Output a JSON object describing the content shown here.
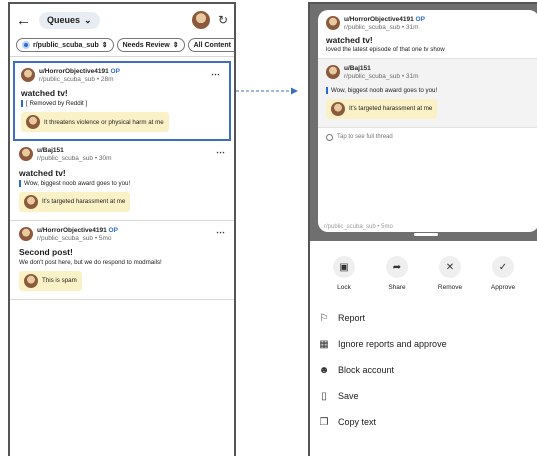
{
  "left": {
    "header": {
      "queue_label": "Queues",
      "chevron": "chevron-down-icon",
      "refresh_icon": "refresh-icon"
    },
    "filters": [
      {
        "label": "r/public_scuba_sub"
      },
      {
        "label": "Needs Review"
      },
      {
        "label": "All Content"
      }
    ],
    "posts": [
      {
        "user": "u/HorrorObjective4191",
        "op": "OP",
        "sub_time": "r/public_scuba_sub • 28m",
        "title": "watched tv!",
        "body": "[ Removed by Reddit ]",
        "report": "It threatens violence or physical harm at me"
      },
      {
        "user": "u/Baj151",
        "sub_time": "r/public_scuba_sub • 30m",
        "title": "watched tv!",
        "body": "Wow, biggest noob award goes to you!",
        "report": "It's targeted harassment at me"
      },
      {
        "user": "u/HorrorObjective4191",
        "op": "OP",
        "sub_time": "r/public_scuba_sub • 5mo",
        "title": "Second post!",
        "body": "We don't post here, but we do respond to modmails!",
        "report": "This is spam"
      }
    ]
  },
  "right": {
    "thread": {
      "user": "u/HorrorObjective4191",
      "op": "OP",
      "sub_time": "r/public_scuba_sub • 31m",
      "title": "watched tv!",
      "body": "loved the latest episode of that one tv show",
      "comment_user": "u/Baj151",
      "comment_sub_time": "r/public_scuba_sub • 31m",
      "comment_body": "Wow, biggest noob award goes to you!",
      "comment_report": "It's targeted harassment at me",
      "tap_text": "Tap to see full thread",
      "peek_text": "r/public_scuba_sub • 5mo"
    },
    "actions": [
      {
        "label": "Lock",
        "icon": "lock-icon"
      },
      {
        "label": "Share",
        "icon": "share-icon"
      },
      {
        "label": "Remove",
        "icon": "close-icon"
      },
      {
        "label": "Approve",
        "icon": "check-icon"
      }
    ],
    "menu": [
      {
        "label": "Report",
        "icon": "flag-icon"
      },
      {
        "label": "Ignore reports and approve",
        "icon": "ignore-reports-icon"
      },
      {
        "label": "Block account",
        "icon": "person-icon"
      },
      {
        "label": "Save",
        "icon": "bookmark-icon"
      },
      {
        "label": "Copy text",
        "icon": "copy-icon"
      }
    ]
  },
  "colors": {
    "accent": "#2a6bd1",
    "report_bg": "#fbf1c7",
    "selection_border": "#3c6fbd"
  }
}
